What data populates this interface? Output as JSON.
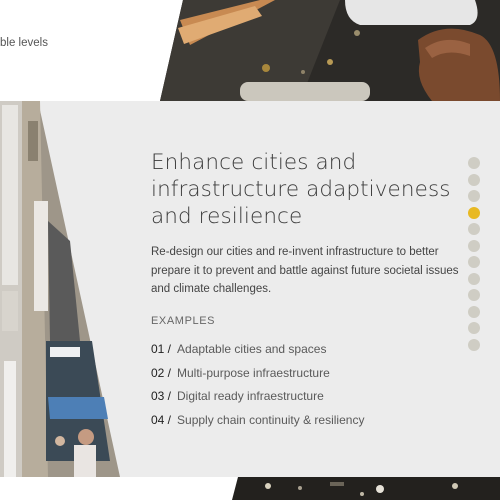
{
  "top": {
    "fragment_text": "ble levels"
  },
  "section": {
    "heading": "Enhance cities and infrastructure adaptiveness and resilience",
    "description": "Re-design our cities and re-invent infrastructure to better prepare it to prevent and battle against future societal issues and climate challenges.",
    "examples_title": "EXAMPLES",
    "examples": [
      {
        "num": "01 /",
        "label": "Adaptable cities and spaces"
      },
      {
        "num": "02 /",
        "label": "Multi-purpose infraestructure"
      },
      {
        "num": "03 /",
        "label": "Digital ready infraestructure"
      },
      {
        "num": "04 /",
        "label": "Supply chain continuity & resiliency"
      }
    ]
  },
  "pager": {
    "total": 12,
    "active_index": 3
  },
  "colors": {
    "panel_background": "#ececec",
    "dot_inactive": "#cfcdc4",
    "dot_active": "#e8b923",
    "heading": "#3a3a3a"
  }
}
